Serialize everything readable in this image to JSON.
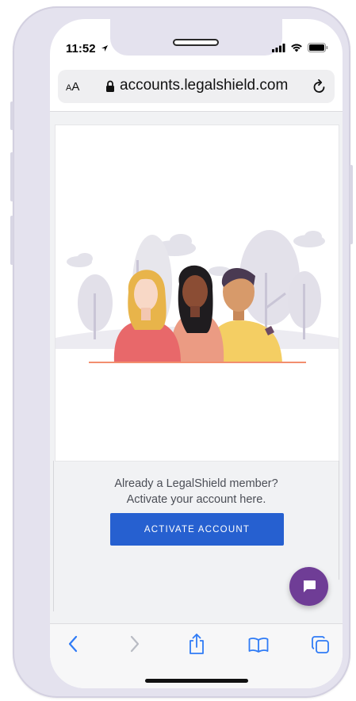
{
  "status": {
    "time": "11:52"
  },
  "browser": {
    "text_size_label_small": "A",
    "text_size_label_big": "A",
    "url": "accounts.legalshield.com"
  },
  "page": {
    "prompt_line1": "Already a LegalShield member?",
    "prompt_line2": "Activate your account here.",
    "activate_label": "ACTIVATE ACCOUNT"
  },
  "colors": {
    "primary_button": "#2660d0",
    "chat_button": "#6f3d96",
    "ios_blue": "#2f7bf6"
  },
  "icons": {
    "status": [
      "location-arrow-icon",
      "signal-icon",
      "wifi-icon",
      "battery-icon"
    ],
    "url_bar": [
      "lock-icon",
      "reload-icon"
    ],
    "toolbar": [
      "back-icon",
      "forward-icon",
      "share-icon",
      "bookmarks-icon",
      "tabs-icon"
    ],
    "floating": [
      "chat-icon"
    ]
  }
}
